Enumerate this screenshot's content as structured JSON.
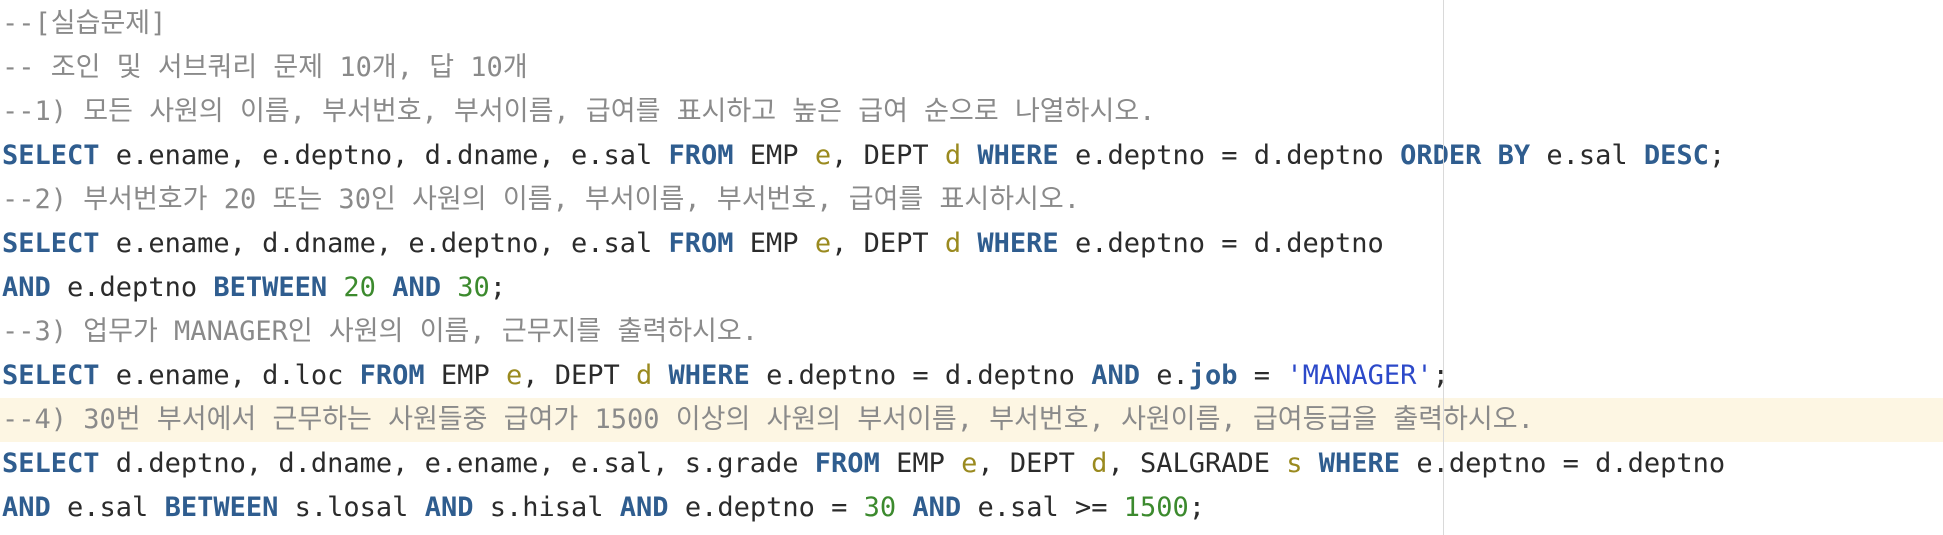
{
  "editor": {
    "lines": [
      {
        "current": false,
        "tokens": [
          {
            "t": "cm",
            "v": "--[실습문제]"
          }
        ]
      },
      {
        "current": false,
        "tokens": [
          {
            "t": "cm",
            "v": "-- 조인 및 서브쿼리 문제 10개, 답 10개"
          }
        ]
      },
      {
        "current": false,
        "tokens": [
          {
            "t": "cm",
            "v": "--1) 모든 사원의 이름, 부서번호, 부서이름, 급여를 표시하고 높은 급여 순으로 나열하시오."
          }
        ]
      },
      {
        "current": false,
        "tokens": [
          {
            "t": "kw",
            "v": "SELECT"
          },
          {
            "t": "id",
            "v": " e.ename, e.deptno, d.dname, e.sal "
          },
          {
            "t": "kw",
            "v": "FROM"
          },
          {
            "t": "id",
            "v": " EMP "
          },
          {
            "t": "al",
            "v": "e"
          },
          {
            "t": "id",
            "v": ", DEPT "
          },
          {
            "t": "al",
            "v": "d"
          },
          {
            "t": "id",
            "v": " "
          },
          {
            "t": "kw",
            "v": "WHERE"
          },
          {
            "t": "id",
            "v": " e.deptno = d.deptno "
          },
          {
            "t": "kw",
            "v": "ORDER BY"
          },
          {
            "t": "id",
            "v": " e.sal "
          },
          {
            "t": "kw",
            "v": "DESC"
          },
          {
            "t": "id",
            "v": ";"
          }
        ]
      },
      {
        "current": false,
        "tokens": [
          {
            "t": "cm",
            "v": "--2) 부서번호가 20 또는 30인 사원의 이름, 부서이름, 부서번호, 급여를 표시하시오."
          }
        ]
      },
      {
        "current": false,
        "tokens": [
          {
            "t": "kw",
            "v": "SELECT"
          },
          {
            "t": "id",
            "v": " e.ename, d.dname, e.deptno, e.sal "
          },
          {
            "t": "kw",
            "v": "FROM"
          },
          {
            "t": "id",
            "v": " EMP "
          },
          {
            "t": "al",
            "v": "e"
          },
          {
            "t": "id",
            "v": ", DEPT "
          },
          {
            "t": "al",
            "v": "d"
          },
          {
            "t": "id",
            "v": " "
          },
          {
            "t": "kw",
            "v": "WHERE"
          },
          {
            "t": "id",
            "v": " e.deptno = d.deptno"
          }
        ]
      },
      {
        "current": false,
        "tokens": [
          {
            "t": "kw",
            "v": "AND"
          },
          {
            "t": "id",
            "v": " e.deptno "
          },
          {
            "t": "kw",
            "v": "BETWEEN"
          },
          {
            "t": "id",
            "v": " "
          },
          {
            "t": "nm",
            "v": "20"
          },
          {
            "t": "id",
            "v": " "
          },
          {
            "t": "kw",
            "v": "AND"
          },
          {
            "t": "id",
            "v": " "
          },
          {
            "t": "nm",
            "v": "30"
          },
          {
            "t": "id",
            "v": ";"
          }
        ]
      },
      {
        "current": false,
        "tokens": [
          {
            "t": "cm",
            "v": "--3) 업무가 MANAGER인 사원의 이름, 근무지를 출력하시오."
          }
        ]
      },
      {
        "current": false,
        "tokens": [
          {
            "t": "kw",
            "v": "SELECT"
          },
          {
            "t": "id",
            "v": " e.ename, d.loc "
          },
          {
            "t": "kw",
            "v": "FROM"
          },
          {
            "t": "id",
            "v": " EMP "
          },
          {
            "t": "al",
            "v": "e"
          },
          {
            "t": "id",
            "v": ", DEPT "
          },
          {
            "t": "al",
            "v": "d"
          },
          {
            "t": "id",
            "v": " "
          },
          {
            "t": "kw",
            "v": "WHERE"
          },
          {
            "t": "id",
            "v": " e.deptno = d.deptno "
          },
          {
            "t": "kw",
            "v": "AND"
          },
          {
            "t": "id",
            "v": " e."
          },
          {
            "t": "kw",
            "v": "job"
          },
          {
            "t": "id",
            "v": " = "
          },
          {
            "t": "st",
            "v": "'MANAGER'"
          },
          {
            "t": "id",
            "v": ";"
          }
        ]
      },
      {
        "current": true,
        "tokens": [
          {
            "t": "cm",
            "v": "--4) 30번 부서에서 근무하는 사원들중 급여가 1500 이상의 사원의 부서이름, 부서번호, 사원이름, 급여등급을 출력하시오."
          }
        ]
      },
      {
        "current": false,
        "tokens": [
          {
            "t": "kw",
            "v": "SELECT"
          },
          {
            "t": "id",
            "v": " d.deptno, d.dname, e.ename, e.sal, s.grade "
          },
          {
            "t": "kw",
            "v": "FROM"
          },
          {
            "t": "id",
            "v": " EMP "
          },
          {
            "t": "al",
            "v": "e"
          },
          {
            "t": "id",
            "v": ", DEPT "
          },
          {
            "t": "al",
            "v": "d"
          },
          {
            "t": "id",
            "v": ", SALGRADE "
          },
          {
            "t": "al",
            "v": "s"
          },
          {
            "t": "id",
            "v": " "
          },
          {
            "t": "kw",
            "v": "WHERE"
          },
          {
            "t": "id",
            "v": " e.deptno = d.deptno"
          }
        ]
      },
      {
        "current": false,
        "tokens": [
          {
            "t": "kw",
            "v": "AND"
          },
          {
            "t": "id",
            "v": " e.sal "
          },
          {
            "t": "kw",
            "v": "BETWEEN"
          },
          {
            "t": "id",
            "v": " s.losal "
          },
          {
            "t": "kw",
            "v": "AND"
          },
          {
            "t": "id",
            "v": " s.hisal "
          },
          {
            "t": "kw",
            "v": "AND"
          },
          {
            "t": "id",
            "v": " e.deptno = "
          },
          {
            "t": "nm",
            "v": "30"
          },
          {
            "t": "id",
            "v": " "
          },
          {
            "t": "kw",
            "v": "AND"
          },
          {
            "t": "id",
            "v": " e.sal >= "
          },
          {
            "t": "nm",
            "v": "1500"
          },
          {
            "t": "id",
            "v": ";"
          }
        ]
      }
    ]
  }
}
